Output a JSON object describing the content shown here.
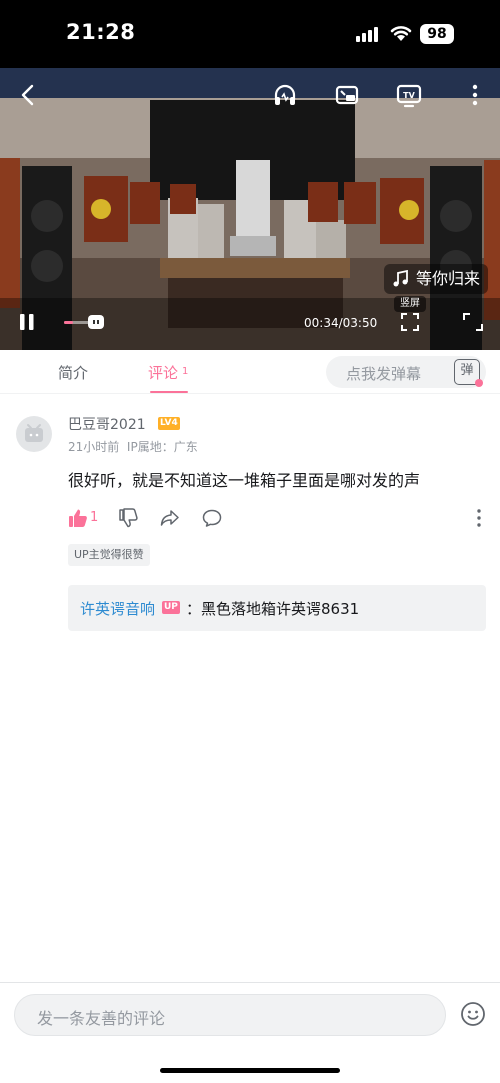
{
  "status_bar": {
    "time": "21:28",
    "battery": "98"
  },
  "video": {
    "song_title": "等你归来",
    "portrait_label": "竖屏",
    "current_time": "00:34",
    "duration": "03:50",
    "time_display": "00:34/03:50",
    "progress_fraction": 0.148,
    "top_icons": [
      "back-icon",
      "headphones-icon",
      "picture-in-picture-icon",
      "tv-cast-icon",
      "more-vertical-icon"
    ]
  },
  "tabs": {
    "intro_label": "简介",
    "comments_label": "评论",
    "comments_count": "1",
    "danmaku_placeholder": "点我发弹幕",
    "danmaku_button_label": "弹"
  },
  "comment": {
    "username": "巴豆哥2021",
    "level": "LV4",
    "time": "21小时前",
    "ip_location": "IP属地：广东",
    "text": "很好听，就是不知道这一堆箱子里面是哪对发的声",
    "like_count": "1",
    "up_badge": "UP主觉得很赞",
    "reply": {
      "author": "许英谔音响",
      "author_tag": "UP",
      "text": "：黑色落地箱许英谔8631"
    }
  },
  "bottom": {
    "input_placeholder": "发一条友善的评论"
  },
  "colors": {
    "accent": "#fb7299",
    "link": "#2e8bd1",
    "level_badge": "#ffb027"
  }
}
